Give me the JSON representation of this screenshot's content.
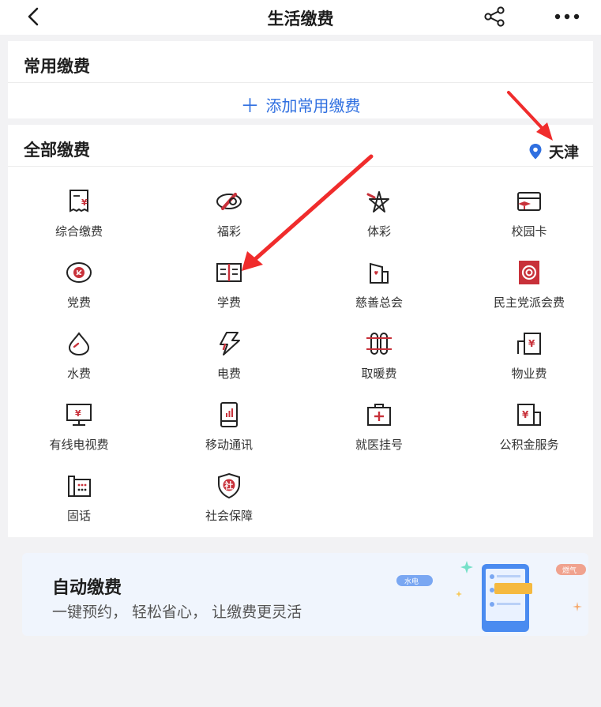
{
  "nav": {
    "title": "生活缴费"
  },
  "common": {
    "title": "常用缴费",
    "add_label": "添加常用缴费"
  },
  "all": {
    "title": "全部缴费",
    "city": "天津",
    "items": [
      {
        "label": "综合缴费",
        "icon": "bill-icon"
      },
      {
        "label": "福彩",
        "icon": "lottery-icon"
      },
      {
        "label": "体彩",
        "icon": "sports-lottery-icon"
      },
      {
        "label": "校园卡",
        "icon": "campus-card-icon"
      },
      {
        "label": "党费",
        "icon": "party-icon"
      },
      {
        "label": "学费",
        "icon": "book-icon"
      },
      {
        "label": "慈善总会",
        "icon": "charity-icon"
      },
      {
        "label": "民主党派会费",
        "icon": "democratic-party-icon"
      },
      {
        "label": "水费",
        "icon": "water-drop-icon"
      },
      {
        "label": "电费",
        "icon": "lightning-icon"
      },
      {
        "label": "取暖费",
        "icon": "radiator-icon"
      },
      {
        "label": "物业费",
        "icon": "property-icon"
      },
      {
        "label": "有线电视费",
        "icon": "tv-icon"
      },
      {
        "label": "移动通讯",
        "icon": "phone-icon"
      },
      {
        "label": "就医挂号",
        "icon": "medical-icon"
      },
      {
        "label": "公积金服务",
        "icon": "fund-icon"
      },
      {
        "label": "固话",
        "icon": "landline-icon"
      },
      {
        "label": "社会保障",
        "icon": "shield-icon"
      }
    ]
  },
  "banner": {
    "title": "自动缴费",
    "subtitle": "一键预约， 轻松省心， 让缴费更灵活",
    "tag_left": "水电",
    "tag_right": "燃气"
  },
  "colors": {
    "accent": "#2f6fe0",
    "icon_red": "#c8313a",
    "pin_blue": "#2f6fe0",
    "annotation": "#f02c2c"
  }
}
